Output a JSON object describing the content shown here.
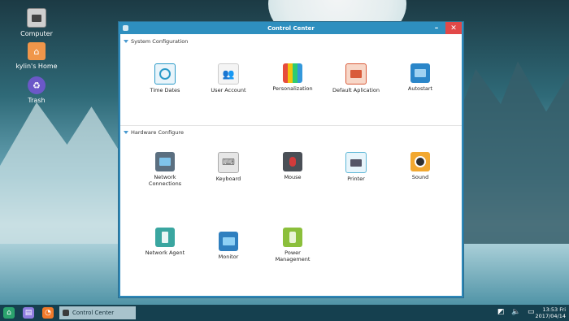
{
  "desktop": {
    "icons": [
      {
        "label": "Computer",
        "icon": "computer-icon"
      },
      {
        "label": "kylin's Home",
        "icon": "home-folder-icon"
      },
      {
        "label": "Trash",
        "icon": "trash-icon"
      }
    ]
  },
  "window": {
    "title": "Control Center",
    "min_glyph": "–",
    "close_glyph": "✕"
  },
  "sections": {
    "system": {
      "title": "System Configuration",
      "items": [
        {
          "label": "Time Dates",
          "icon": "clock-icon",
          "color": "#2a9ac8"
        },
        {
          "label": "User Account",
          "icon": "users-icon",
          "color": "#e8e8e8"
        },
        {
          "label": "Personalization",
          "icon": "palette-icon",
          "color": "#f29a3a"
        },
        {
          "label": "Default Aplication",
          "icon": "default-app-icon",
          "color": "#d95b3a"
        },
        {
          "label": "Autostart",
          "icon": "autostart-icon",
          "color": "#2a86c9"
        }
      ]
    },
    "hardware": {
      "title": "Hardware Configure",
      "items": [
        {
          "label": "Network Connections",
          "icon": "network-icon",
          "color": "#5b6f80"
        },
        {
          "label": "Keyboard",
          "icon": "keyboard-icon",
          "color": "#bfbfbf"
        },
        {
          "label": "Mouse",
          "icon": "mouse-icon",
          "color": "#4a4f56"
        },
        {
          "label": "Printer",
          "icon": "printer-icon",
          "color": "#5eb7d6"
        },
        {
          "label": "Sound",
          "icon": "speaker-icon",
          "color": "#f2a830"
        },
        {
          "label": "Network Agent",
          "icon": "server-icon",
          "color": "#3aa6a0"
        },
        {
          "label": "Monitor",
          "icon": "monitor-icon",
          "color": "#2f7fbf"
        },
        {
          "label": "Power Management",
          "icon": "power-icon",
          "color": "#8bbf3b"
        }
      ]
    }
  },
  "taskbar": {
    "task_label": "Control Center",
    "time": "13:53 Fri",
    "date": "2017/04/14"
  }
}
